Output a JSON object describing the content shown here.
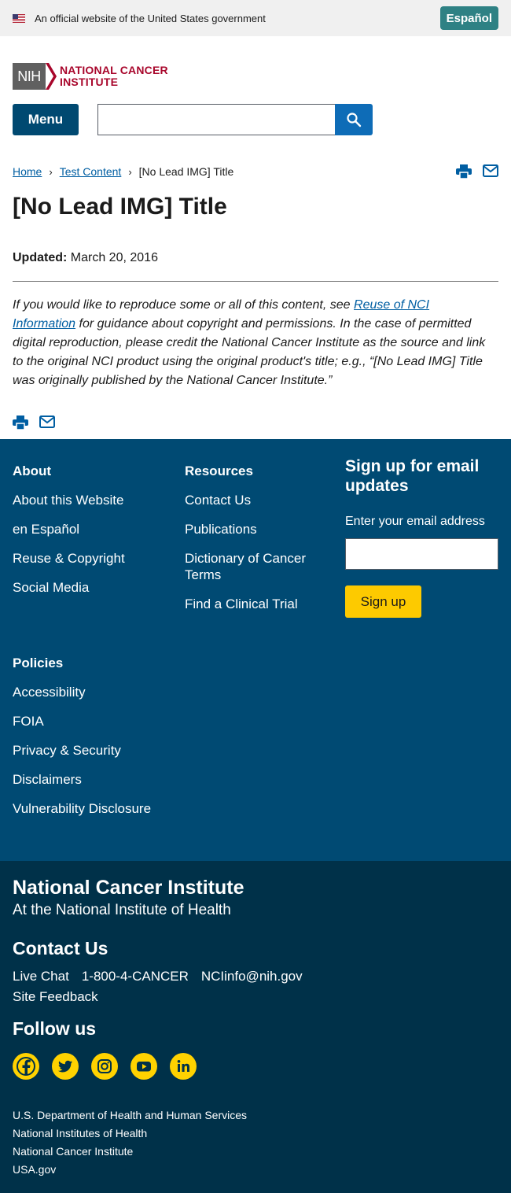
{
  "gov_banner": {
    "text": "An official website of the United States government",
    "espanol_label": "Español"
  },
  "header": {
    "nih_label": "NIH",
    "org_line1": "NATIONAL CANCER",
    "org_line2": "INSTITUTE",
    "menu_label": "Menu",
    "search_value": ""
  },
  "breadcrumb": {
    "items": [
      "Home",
      "Test Content",
      "[No Lead IMG] Title"
    ]
  },
  "main": {
    "title": "[No Lead IMG] Title",
    "updated_label": "Updated:",
    "updated_date": "March 20, 2016",
    "reuse_pre": "If you would like to reproduce some or all of this content, see ",
    "reuse_link": "Reuse of NCI Information",
    "reuse_post": " for guidance about copyright and permissions. In the case of permitted digital reproduction, please credit the National Cancer Institute as the source and link to the original NCI product using the original product's title; e.g., “[No Lead IMG] Title was originally published by the National Cancer Institute.”"
  },
  "footer": {
    "about": {
      "heading": "About",
      "links": [
        "About this Website",
        "en Español",
        "Reuse & Copyright",
        "Social Media"
      ]
    },
    "resources": {
      "heading": "Resources",
      "links": [
        "Contact Us",
        "Publications",
        "Dictionary of Cancer Terms",
        "Find a Clinical Trial"
      ]
    },
    "policies": {
      "heading": "Policies",
      "links": [
        "Accessibility",
        "FOIA",
        "Privacy & Security",
        "Disclaimers",
        "Vulnerability Disclosure"
      ]
    },
    "signup": {
      "title": "Sign up for email updates",
      "email_label": "Enter your email address",
      "email_value": "",
      "button_label": "Sign up"
    }
  },
  "footer_bottom": {
    "org_name": "National Cancer Institute",
    "org_sub": "At the National Institute of Health",
    "contact_heading": "Contact Us",
    "contact_links": [
      "Live Chat",
      "1-800-4-CANCER",
      "NCIinfo@nih.gov"
    ],
    "site_feedback": "Site Feedback",
    "follow_heading": "Follow us",
    "social_icons": [
      "facebook-icon",
      "twitter-icon",
      "instagram-icon",
      "youtube-icon",
      "linkedin-icon"
    ],
    "agency_links": [
      "U.S. Department of Health and Human Services",
      "National Institutes of Health",
      "National Cancer Institute",
      "USA.gov"
    ]
  },
  "colors": {
    "footer_top_bg": "#004a73",
    "footer_bottom_bg": "#003149",
    "accent_yellow": "#ffd200",
    "brand_red": "#a8062b",
    "link_blue": "#005ea2"
  }
}
